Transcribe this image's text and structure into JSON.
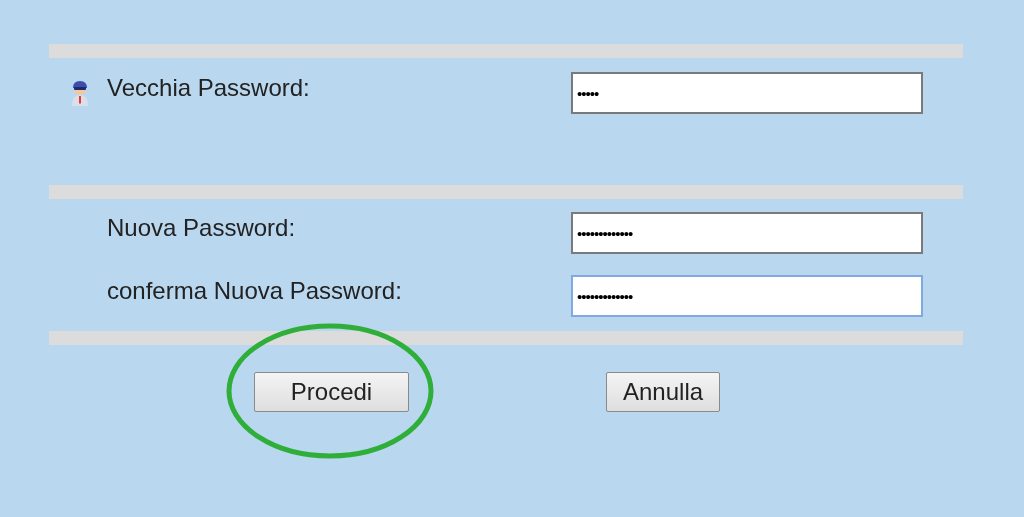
{
  "sections": [
    {
      "fields": [
        {
          "label": "Vecchia Password:",
          "value": "•••••",
          "focused": false,
          "icon": true
        }
      ]
    },
    {
      "fields": [
        {
          "label": "Nuova Password:",
          "value": "•••••••••••••",
          "focused": false,
          "icon": false
        },
        {
          "label": "conferma Nuova Password:",
          "value": "•••••••••••••",
          "focused": true,
          "icon": false
        }
      ]
    }
  ],
  "buttons": [
    {
      "label": "Procedi",
      "highlighted": true
    },
    {
      "label": "Annulla",
      "highlighted": false
    }
  ]
}
